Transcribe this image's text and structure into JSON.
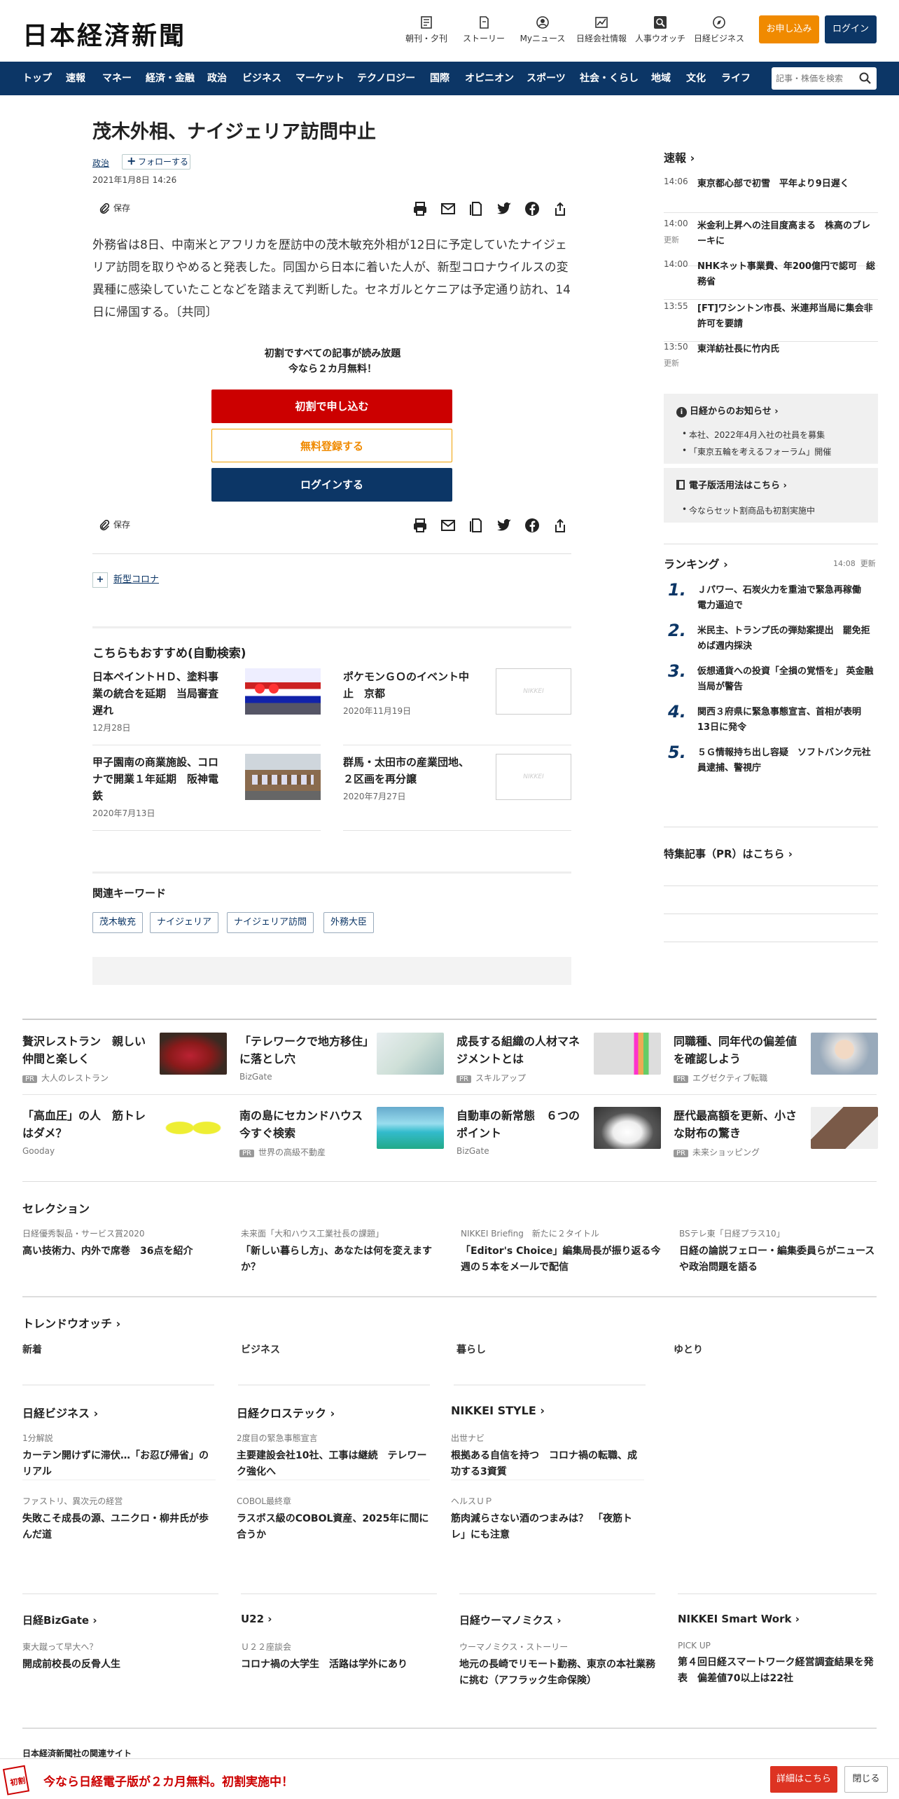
{
  "header": {
    "logo": "日本経済新聞",
    "icons": [
      {
        "label": "朝刊・夕刊",
        "icon": "newspaper-icon"
      },
      {
        "label": "ストーリー",
        "icon": "story-icon"
      },
      {
        "label": "Myニュース",
        "icon": "user-icon"
      },
      {
        "label": "日経会社情報",
        "icon": "chart-icon"
      },
      {
        "label": "人事ウオッチ",
        "icon": "search-person-icon"
      },
      {
        "label": "日経ビジネス",
        "icon": "compass-icon"
      }
    ],
    "apply_label": "お申し込み",
    "login_label": "ログイン"
  },
  "nav": {
    "items": [
      "トップ",
      "速報",
      "マネー",
      "経済・金融",
      "政治",
      "ビジネス",
      "マーケット",
      "テクノロジー",
      "国際",
      "オピニオン",
      "スポーツ",
      "社会・くらし",
      "地域",
      "文化",
      "ライフ"
    ],
    "search_placeholder": "記事・株価を検索"
  },
  "article": {
    "title": "茂木外相、ナイジェリア訪問中止",
    "tag": "政治",
    "follow_label": "フォローする",
    "date": "2021年1月8日 14:26",
    "save_label": "保存",
    "body": "外務省は8日、中南米とアフリカを歴訪中の茂木敏充外相が12日に予定していたナイジェリア訪問を取りやめると発表した。同国から日本に着いた人が、新型コロナウイルスの変異種に感染していたことなどを踏まえて判断した。セネガルとケニアは予定通り訪れ、14日に帰国する。〔共同〕",
    "promo_line1": "初割ですべての記事が読み放題",
    "promo_line2": "今なら２カ月無料！",
    "promo_btn1": "初割で申し込む",
    "promo_btn2": "無料登録する",
    "promo_btn3": "ログインする",
    "topic": "新型コロナ"
  },
  "recommend": {
    "title": "こちらもおすすめ(自動検索)",
    "items": [
      {
        "title": "日本ペイントＨＤ、塗料事業の統合を延期　当局審査遅れ",
        "date": "12月28日"
      },
      {
        "title": "ポケモンＧＯのイベント中止　京都",
        "date": "2020年11月19日"
      },
      {
        "title": "甲子園南の商業施設、コロナで開業１年延期　阪神電鉄",
        "date": "2020年7月13日"
      },
      {
        "title": "群馬・太田市の産業団地、２区画を再分譲",
        "date": "2020年7月27日"
      }
    ],
    "placeholder_text": "NIKKEI"
  },
  "keywords": {
    "title": "関連キーワード",
    "items": [
      "茂木敏充",
      "ナイジェリア",
      "ナイジェリア訪問",
      "外務大臣"
    ]
  },
  "sidebar": {
    "flash_title": "速報",
    "flash": [
      {
        "time": "14:06",
        "text": "東京都心部で初雪　平年より9日遅く",
        "updated": ""
      },
      {
        "time": "14:00",
        "text": "米金利上昇への注目度高まる　株高のブレーキに",
        "updated": "更新"
      },
      {
        "time": "14:00",
        "text": "NHKネット事業費、年200億円で認可　総務省",
        "updated": ""
      },
      {
        "time": "13:55",
        "text": "[FT]ワシントン市長、米連邦当局に集会非許可を要請",
        "updated": ""
      },
      {
        "time": "13:50",
        "text": "東洋紡社長に竹内氏",
        "updated": "更新"
      }
    ],
    "notice_title": "日経からのお知らせ",
    "notices": [
      "本社、2022年4月入社の社員を募集",
      "「東京五輪を考えるフォーラム」開催"
    ],
    "epaper_title": "電子版活用法はこちら",
    "epaper_items": [
      "今ならセット割商品も初割実施中"
    ],
    "ranking_title": "ランキング",
    "ranking_time": "14:08",
    "ranking_updated": "更新",
    "ranking": [
      {
        "n": "1.",
        "text": "Ｊパワー、石炭火力を重油で緊急再稼働　電力逼迫で"
      },
      {
        "n": "2.",
        "text": "米民主、トランプ氏の弾劾案提出　罷免拒めば週内採決"
      },
      {
        "n": "3.",
        "text": "仮想通貨への投資「全損の覚悟を」 英金融当局が警告"
      },
      {
        "n": "4.",
        "text": "関西３府県に緊急事態宣言、首相が表明　13日に発令"
      },
      {
        "n": "5.",
        "text": "５Ｇ情報持ち出し容疑　ソフトバンク元社員逮捕、警視庁"
      }
    ],
    "pr_title": "特集記事（PR）はこちら"
  },
  "ads": [
    {
      "text": "贅沢レストラン　親しい仲間と楽しく",
      "source": "大人のレストラン",
      "pr": true
    },
    {
      "text": "「テレワークで地方移住」に落とし穴",
      "source": "BizGate",
      "pr": false
    },
    {
      "text": "成長する組織の人材マネジメントとは",
      "source": "スキルアップ",
      "pr": true
    },
    {
      "text": "同職種、同年代の偏差値を確認しよう",
      "source": "エグゼクティブ転職",
      "pr": true
    },
    {
      "text": "「高血圧」の人　筋トレはダメ？",
      "source": "Gooday",
      "pr": false
    },
    {
      "text": "南の島にセカンドハウス　今すぐ検索",
      "source": "世界の高級不動産",
      "pr": true
    },
    {
      "text": "自動車の新常態　６つのポイント",
      "source": "BizGate",
      "pr": false
    },
    {
      "text": "歴代最高額を更新、小さな財布の驚き",
      "source": "未来ショッピング",
      "pr": true
    }
  ],
  "pr_label": "PR",
  "selection": {
    "title": "セレクション",
    "items": [
      {
        "kicker": "日経優秀製品・サービス賞2020",
        "text": "高い技術力、内外で席巻　36点を紹介"
      },
      {
        "kicker": "未来面「大和ハウス工業社長の課題」",
        "text": "「新しい暮らし方」、あなたは何を変えますか？"
      },
      {
        "kicker": "NIKKEI Briefing　新たに２タイトル",
        "text": "「Editor's Choice」編集局長が振り返る今週の５本をメールで配信"
      },
      {
        "kicker": "BSテレ東「日経プラス10」",
        "text": "日経の論説フェロー・編集委員らがニュースや政治問題を語る"
      }
    ]
  },
  "trend": {
    "title": "トレンドウオッチ",
    "tabs": [
      "新着",
      "ビジネス",
      "暮らし",
      "ゆとり"
    ]
  },
  "columns1": [
    {
      "title": "日経ビジネス",
      "items": [
        {
          "kicker": "1分解説",
          "text": "カーテン開けずに滞伏…「お忍び帰省」のリアル"
        },
        {
          "kicker": "ファストリ、異次元の経営",
          "text": "失敗こそ成長の源、ユニクロ・柳井氏が歩んだ道"
        }
      ]
    },
    {
      "title": "日経クロステック",
      "items": [
        {
          "kicker": "2度目の緊急事態宣言",
          "text": "主要建設会社10社、工事は継続　テレワーク強化へ"
        },
        {
          "kicker": "COBOL最終章",
          "text": "ラスボス級のCOBOL資産、2025年に間に合うか"
        }
      ]
    },
    {
      "title": "NIKKEI STYLE",
      "items": [
        {
          "kicker": "出世ナビ",
          "text": "根拠ある自信を持つ　コロナ禍の転職、成功する3資質"
        },
        {
          "kicker": "ヘルスＵＰ",
          "text": "筋肉減らさない酒のつまみは？　「夜筋トレ」にも注意"
        }
      ]
    }
  ],
  "columns2": [
    {
      "title": "日経BizGate",
      "kicker": "東大蹴って早大へ？",
      "text": "開成前校長の反骨人生"
    },
    {
      "title": "U22",
      "kicker": "Ｕ２２座談会",
      "text": "コロナ禍の大学生　活路は学外にあり"
    },
    {
      "title": "日経ウーマノミクス",
      "kicker": "ウーマノミクス・ストーリー",
      "text": "地元の長崎でリモート勤務、東京の本社業務に挑む（アフラック生命保険）"
    },
    {
      "title": "NIKKEI Smart Work",
      "kicker": "PICK UP",
      "text": "第４回日経スマートワーク経営調査結果を発表　偏差値70以上は22社"
    }
  ],
  "footer": {
    "label": "日本経済新聞社の関連サイト",
    "banner_text": "今なら日経電子版が２カ月無料。初割実施中！",
    "badge": "初割",
    "detail_label": "詳細はこちら",
    "close_label": "閉じる"
  },
  "colors": {
    "navy": "#0c3666",
    "orange": "#f08a00",
    "red": "#cc0000"
  }
}
